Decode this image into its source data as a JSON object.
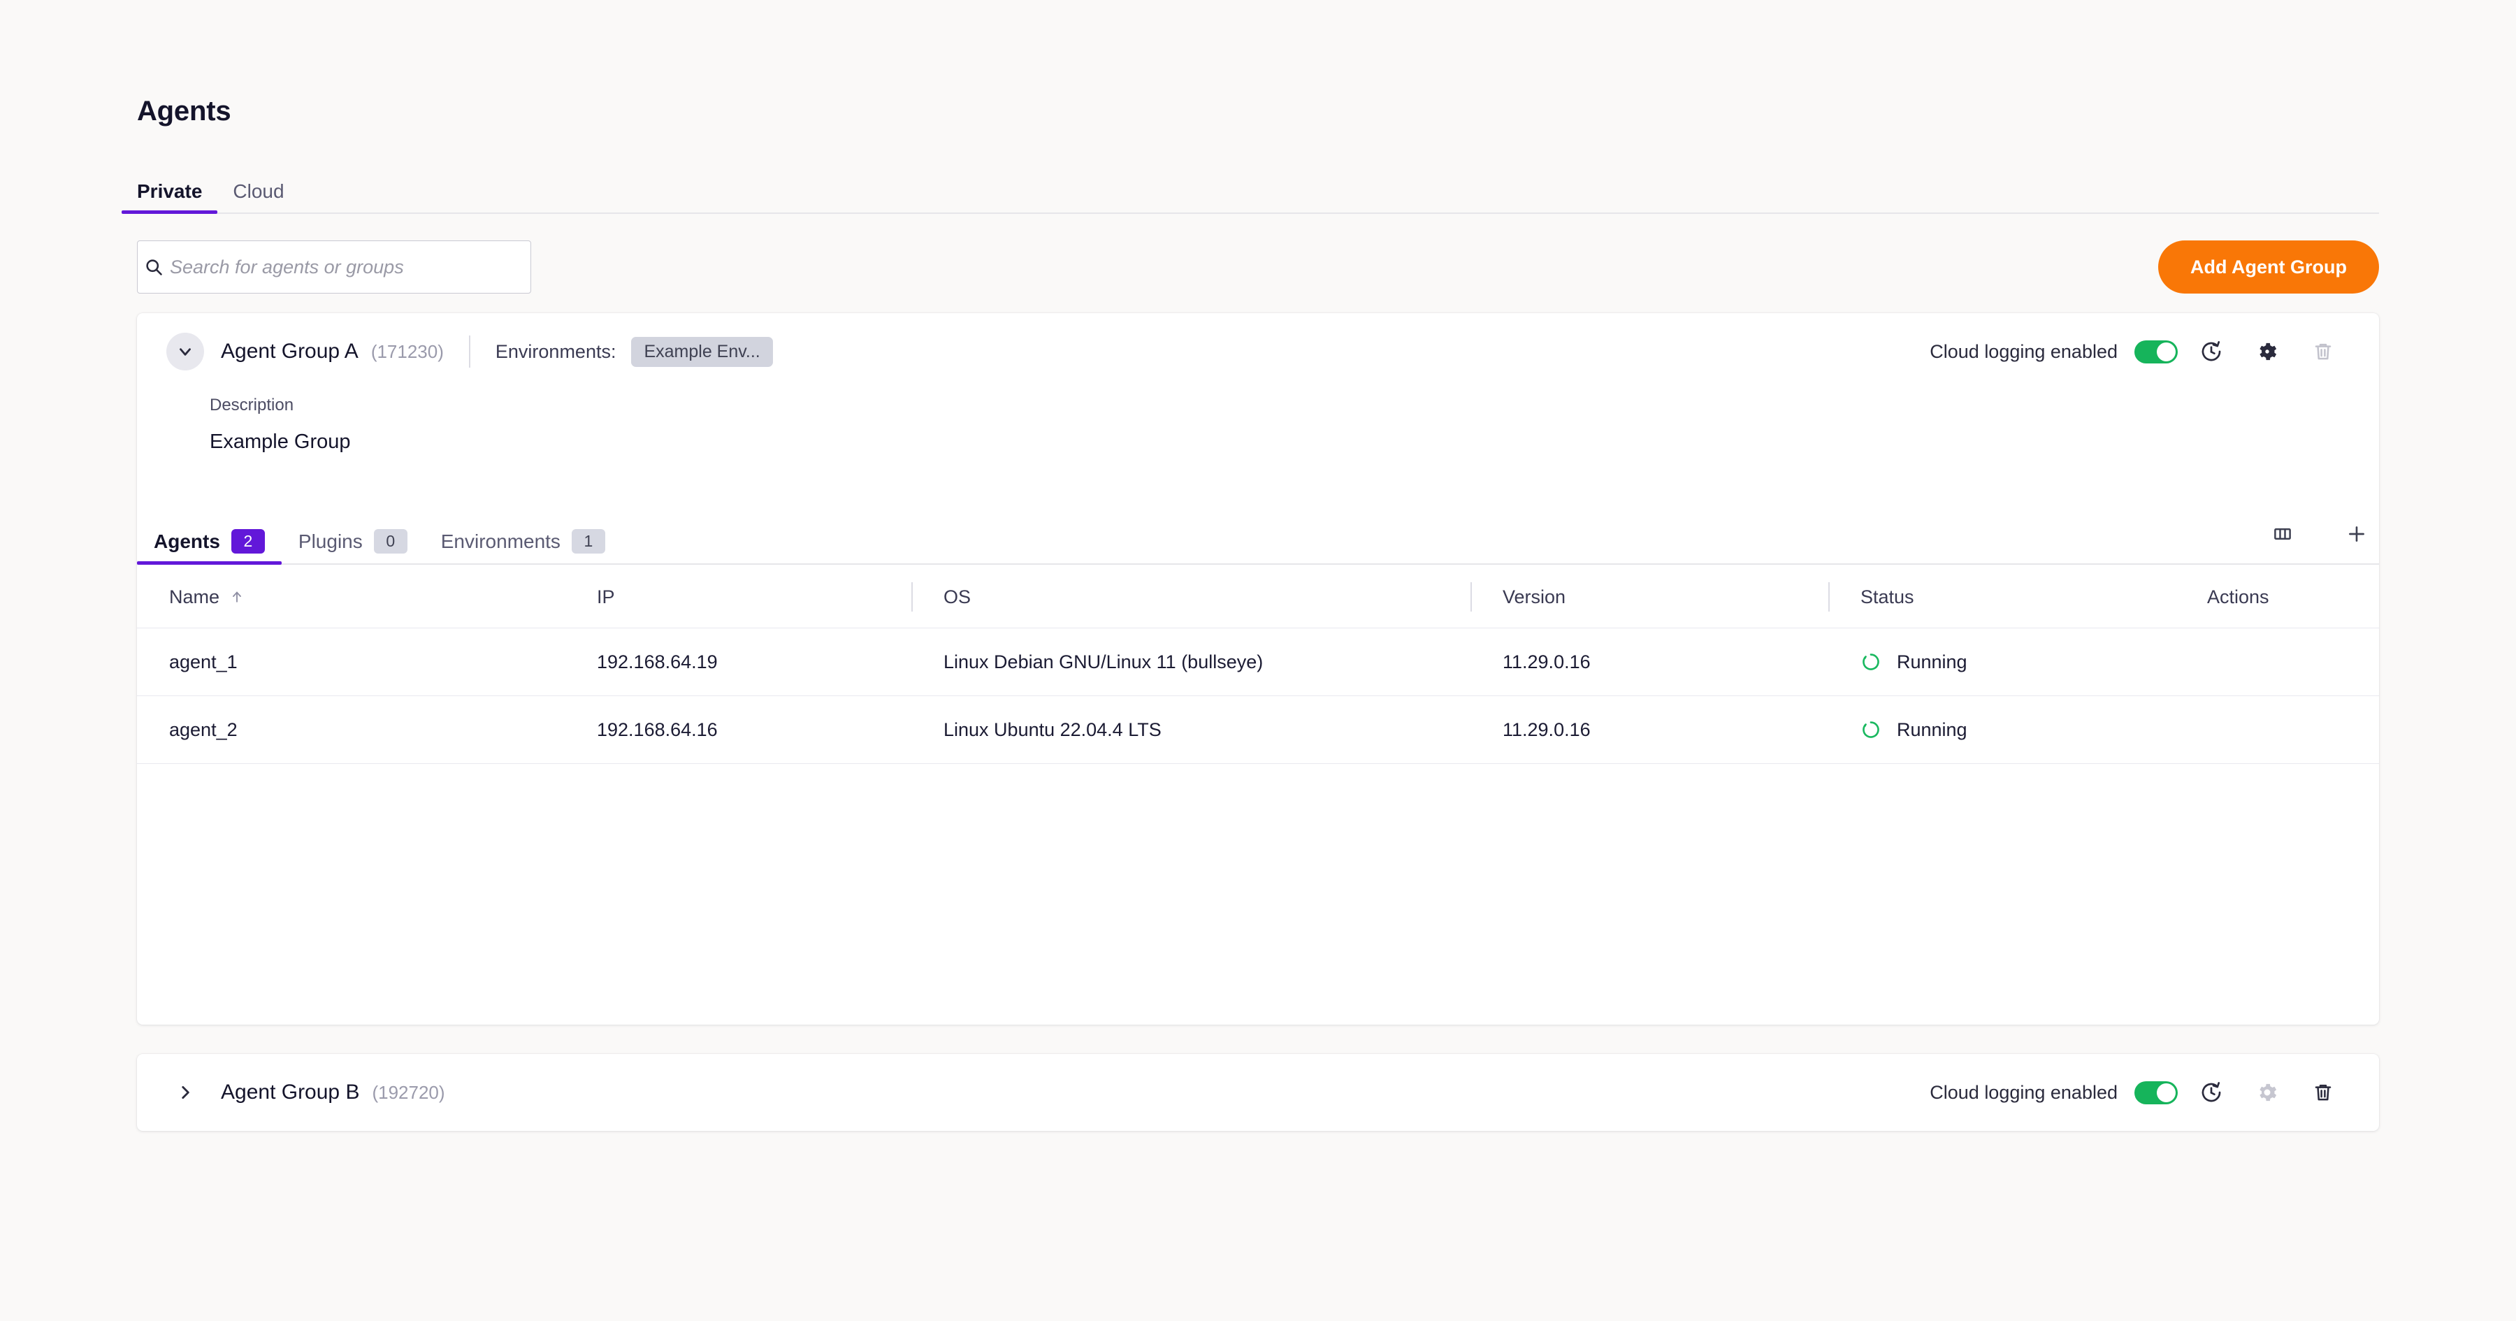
{
  "header": {
    "title": "Agents",
    "tabs": [
      {
        "label": "Private",
        "active": true
      },
      {
        "label": "Cloud",
        "active": false
      }
    ]
  },
  "toolbar": {
    "search_placeholder": "Search for agents or groups",
    "search_value": "",
    "search_icon": "search-icon",
    "add_button_label": "Add Agent Group",
    "add_button_color": "#F97707"
  },
  "groups": [
    {
      "name": "Agent Group A",
      "id": "(171230)",
      "expanded": true,
      "expand_icon": "chevron-down-icon",
      "environments_label": "Environments:",
      "environment_chip": "Example Env...",
      "cloud_logging_label": "Cloud logging enabled",
      "cloud_logging_on": true,
      "toggle_color": "#16B45B",
      "actions": [
        {
          "icon": "history-refresh-icon",
          "disabled": false
        },
        {
          "icon": "gear-icon",
          "disabled": false
        },
        {
          "icon": "trash-icon",
          "disabled": true
        }
      ],
      "description_label": "Description",
      "description_value": "Example Group",
      "inner_tabs": [
        {
          "label": "Agents",
          "count": "2",
          "active": true
        },
        {
          "label": "Plugins",
          "count": "0",
          "active": false
        },
        {
          "label": "Environments",
          "count": "1",
          "active": false
        }
      ],
      "table_tools": [
        {
          "icon": "columns-icon"
        },
        {
          "icon": "plus-icon"
        }
      ],
      "table": {
        "columns": [
          "Name",
          "IP",
          "OS",
          "Version",
          "Status",
          "Actions"
        ],
        "sort_column": "Name",
        "sort_direction": "asc",
        "sort_icon": "arrow-up-icon",
        "rows": [
          {
            "name": "agent_1",
            "ip": "192.168.64.19",
            "os": "Linux Debian GNU/Linux 11 (bullseye)",
            "version": "11.29.0.16",
            "status": "Running",
            "status_icon": "spinner-icon",
            "status_color": "#19B85F",
            "actions": ""
          },
          {
            "name": "agent_2",
            "ip": "192.168.64.16",
            "os": "Linux Ubuntu 22.04.4 LTS",
            "version": "11.29.0.16",
            "status": "Running",
            "status_icon": "spinner-icon",
            "status_color": "#19B85F",
            "actions": ""
          }
        ]
      }
    },
    {
      "name": "Agent Group B",
      "id": "(192720)",
      "expanded": false,
      "expand_icon": "chevron-right-icon",
      "cloud_logging_label": "Cloud logging enabled",
      "cloud_logging_on": true,
      "toggle_color": "#16B45B",
      "actions": [
        {
          "icon": "history-refresh-icon",
          "disabled": false
        },
        {
          "icon": "gear-icon",
          "disabled": true
        },
        {
          "icon": "trash-icon",
          "disabled": false
        }
      ]
    }
  ]
}
